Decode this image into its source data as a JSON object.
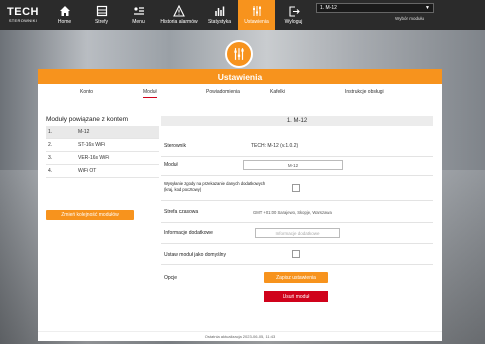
{
  "brand": {
    "name": "TECH",
    "sub": "STEROWNIKI"
  },
  "nav": [
    {
      "label": "Home",
      "icon": "home-icon"
    },
    {
      "label": "Strefy",
      "icon": "zones-icon"
    },
    {
      "label": "Menu",
      "icon": "menu-icon"
    },
    {
      "label": "Historia alarmów",
      "icon": "alarm-icon"
    },
    {
      "label": "Statystyka",
      "icon": "stats-icon"
    },
    {
      "label": "Ustawienia",
      "icon": "settings-icon"
    },
    {
      "label": "Wyloguj",
      "icon": "logout-icon"
    }
  ],
  "module_selector": {
    "value": "1. M-12",
    "caption": "Wybór modułu"
  },
  "panel": {
    "title": "Ustawienia"
  },
  "tabs": [
    "Konto",
    "Moduł",
    "Powiadomienia",
    "Kafelki",
    "Instrukcje obsługi"
  ],
  "modules": {
    "title": "Moduły powiązane z kontem",
    "items": [
      {
        "num": "1.",
        "name": "M-12"
      },
      {
        "num": "2.",
        "name": "ST-16s WiFi"
      },
      {
        "num": "3.",
        "name": "VER-16s WiFi"
      },
      {
        "num": "4.",
        "name": "WiFi OT"
      }
    ],
    "reorder_button": "Zmień kolejność modułów"
  },
  "details": {
    "header": "1. M-12",
    "controller_label": "Sterownik",
    "controller_value": "TECH: M-12 (v.1.0.2)",
    "module_label": "Moduł",
    "module_value": "M-12",
    "email_label": "Wysyłanie zgody na przekazanie danych dodatkowych (kraj, kod pocztowy)",
    "timezone_label": "Strefa czasowa",
    "timezone_value": "GMT +01:00 Sarajewo, Skopje, Warszawa",
    "extra_label": "Informacje dodatkowe",
    "extra_placeholder": "Informacje dodatkowe",
    "default_label": "Ustaw moduł jako domyślny",
    "options_label": "Opcje",
    "save_button": "Zapisz ustawienia",
    "delete_button": "Usuń moduł"
  },
  "footer": "Ostatnia aktualizacja 2023-06-05, 11:43",
  "colors": {
    "accent": "#f7931d",
    "danger": "#d0021b",
    "topbar": "#2b2b2b"
  }
}
